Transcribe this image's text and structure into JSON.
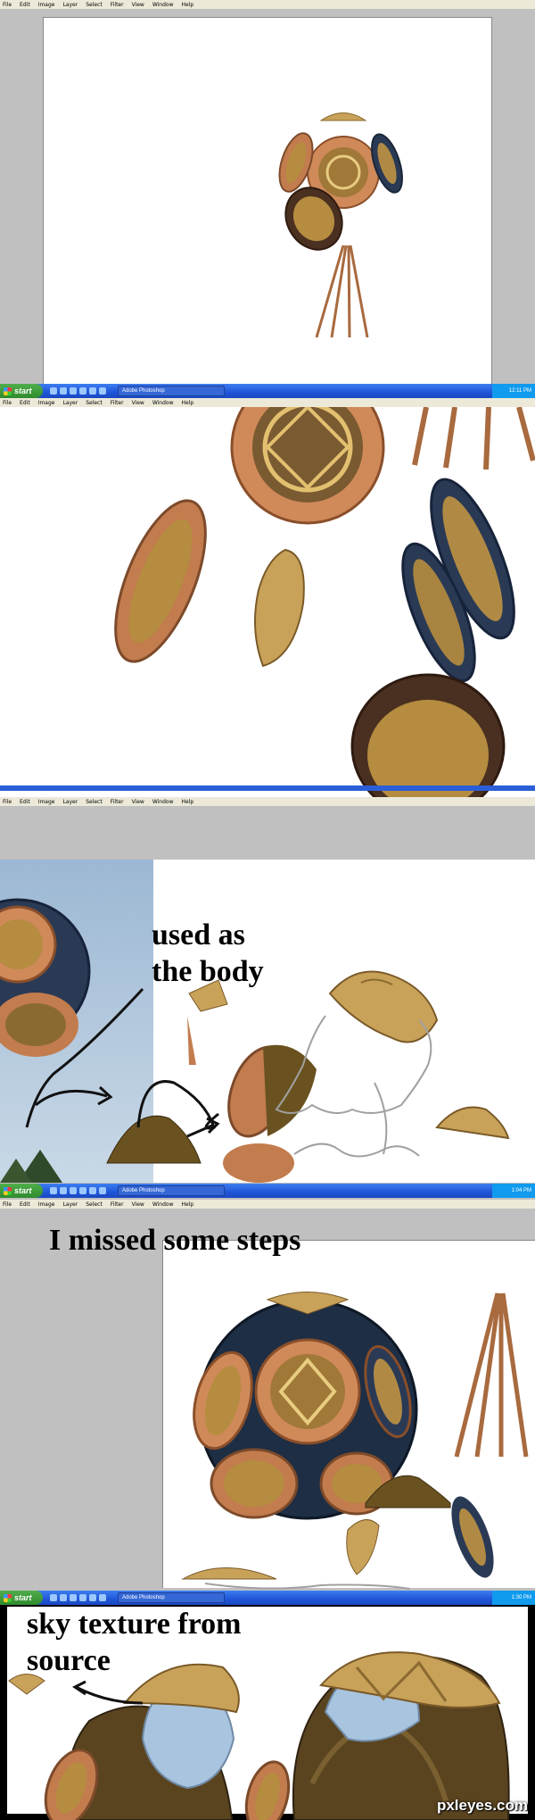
{
  "menu": [
    "File",
    "Edit",
    "Image",
    "Layer",
    "Select",
    "Filter",
    "View",
    "Window",
    "Help"
  ],
  "taskbar": {
    "start_label": "start",
    "window_button": "Adobe Photoshop",
    "clock_1": "12:11 PM",
    "clock_3": "1:04 PM",
    "clock_4": "1:30 PM"
  },
  "captions": {
    "body_line1": "used as",
    "body_line2": "the body",
    "missed_steps": "I missed some steps",
    "sky_line1": "sky texture from",
    "sky_line2": "source"
  },
  "watermark": "pxleyes.com",
  "colors": {
    "copper": "#c0784a",
    "gold": "#c9a25a",
    "navy": "#1e2e44",
    "sky": "#a9c4de",
    "canvas_gray": "#c0c0c0"
  }
}
